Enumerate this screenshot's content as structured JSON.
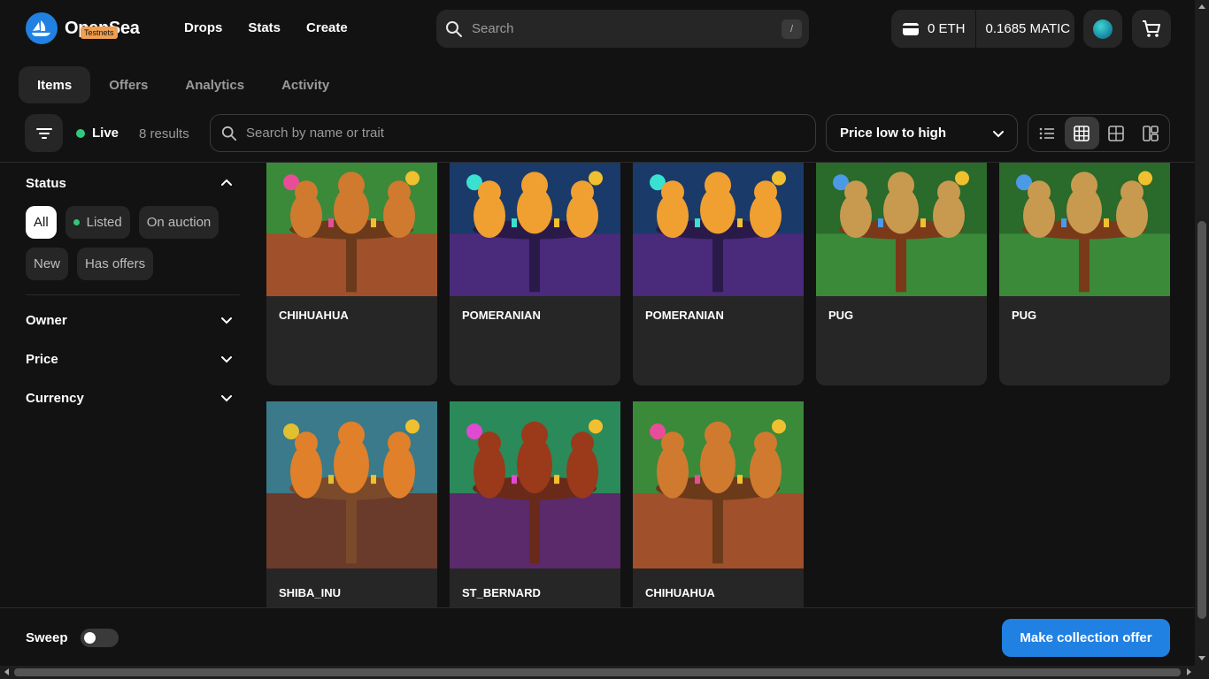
{
  "brand": {
    "name": "OpenSea",
    "badge": "Testnets"
  },
  "nav": {
    "links": [
      "Drops",
      "Stats",
      "Create"
    ]
  },
  "search": {
    "placeholder": "Search",
    "shortcut": "/"
  },
  "wallet": {
    "eth": "0 ETH",
    "matic": "0.1685 MATIC"
  },
  "tabs": [
    {
      "label": "Items",
      "active": true
    },
    {
      "label": "Offers",
      "active": false
    },
    {
      "label": "Analytics",
      "active": false
    },
    {
      "label": "Activity",
      "active": false
    }
  ],
  "filterbar": {
    "live_label": "Live",
    "results": "8 results",
    "trait_placeholder": "Search by name or trait",
    "sort_label": "Price low to high"
  },
  "sidebar": {
    "status_title": "Status",
    "status_chips": [
      "All",
      "Listed",
      "On auction",
      "New",
      "Has offers"
    ],
    "sections": [
      "Owner",
      "Price",
      "Currency"
    ]
  },
  "items": [
    {
      "name": "CHIHUAHUA",
      "theme": "chihuahua"
    },
    {
      "name": "POMERANIAN",
      "theme": "pomeranian"
    },
    {
      "name": "POMERANIAN",
      "theme": "pomeranian"
    },
    {
      "name": "PUG",
      "theme": "pug"
    },
    {
      "name": "PUG",
      "theme": "pug"
    },
    {
      "name": "SHIBA_INU",
      "theme": "shiba"
    },
    {
      "name": "ST_BERNARD",
      "theme": "stbernard"
    },
    {
      "name": "CHIHUAHUA",
      "theme": "chihuahua"
    }
  ],
  "bottombar": {
    "sweep_label": "Sweep",
    "offer_button": "Make collection offer"
  },
  "colors": {
    "accent": "#2081e2",
    "live": "#34c77b",
    "background": "#121212",
    "surface": "#262626"
  }
}
